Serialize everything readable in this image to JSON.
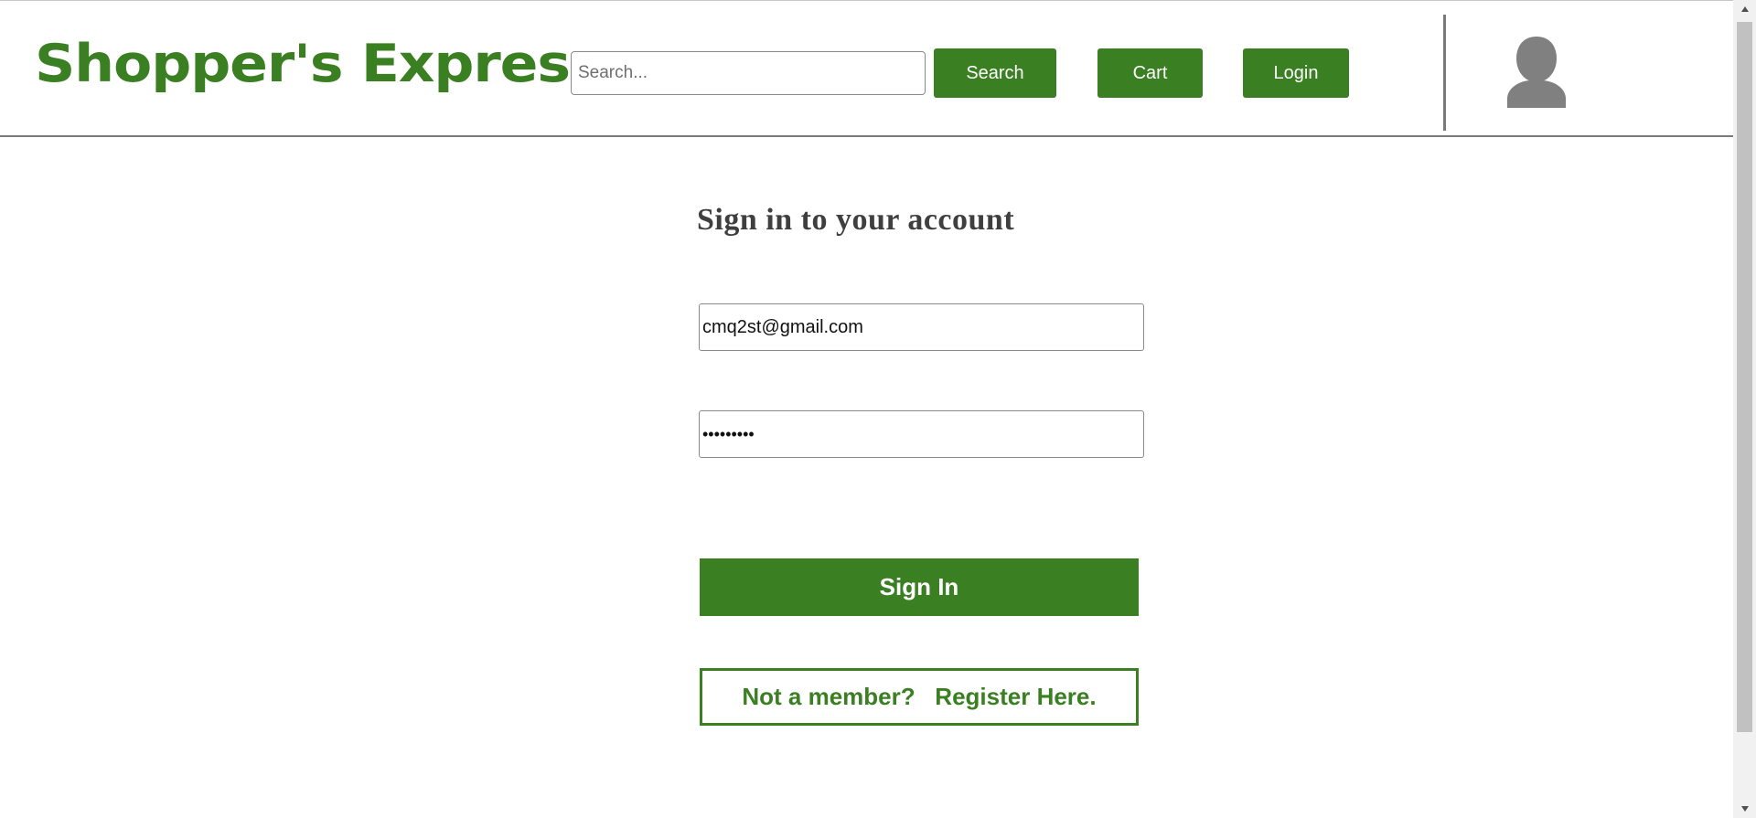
{
  "header": {
    "logo": "Shopper's Express",
    "search": {
      "placeholder": "Search...",
      "value": ""
    },
    "search_button": "Search",
    "cart_button": "Cart",
    "login_button": "Login",
    "avatar_icon": "user-avatar-icon"
  },
  "login_form": {
    "title": "Sign in to your account",
    "email_value": "cmq2st@gmail.com",
    "password_value": "•••••••••",
    "signin_button": "Sign In",
    "register_button": "Not a member?   Register Here."
  },
  "colors": {
    "brand_green": "#3a7f22",
    "title_gray": "#3f3f3f",
    "divider_gray": "#7a7a7a",
    "avatar_gray": "#808080"
  }
}
